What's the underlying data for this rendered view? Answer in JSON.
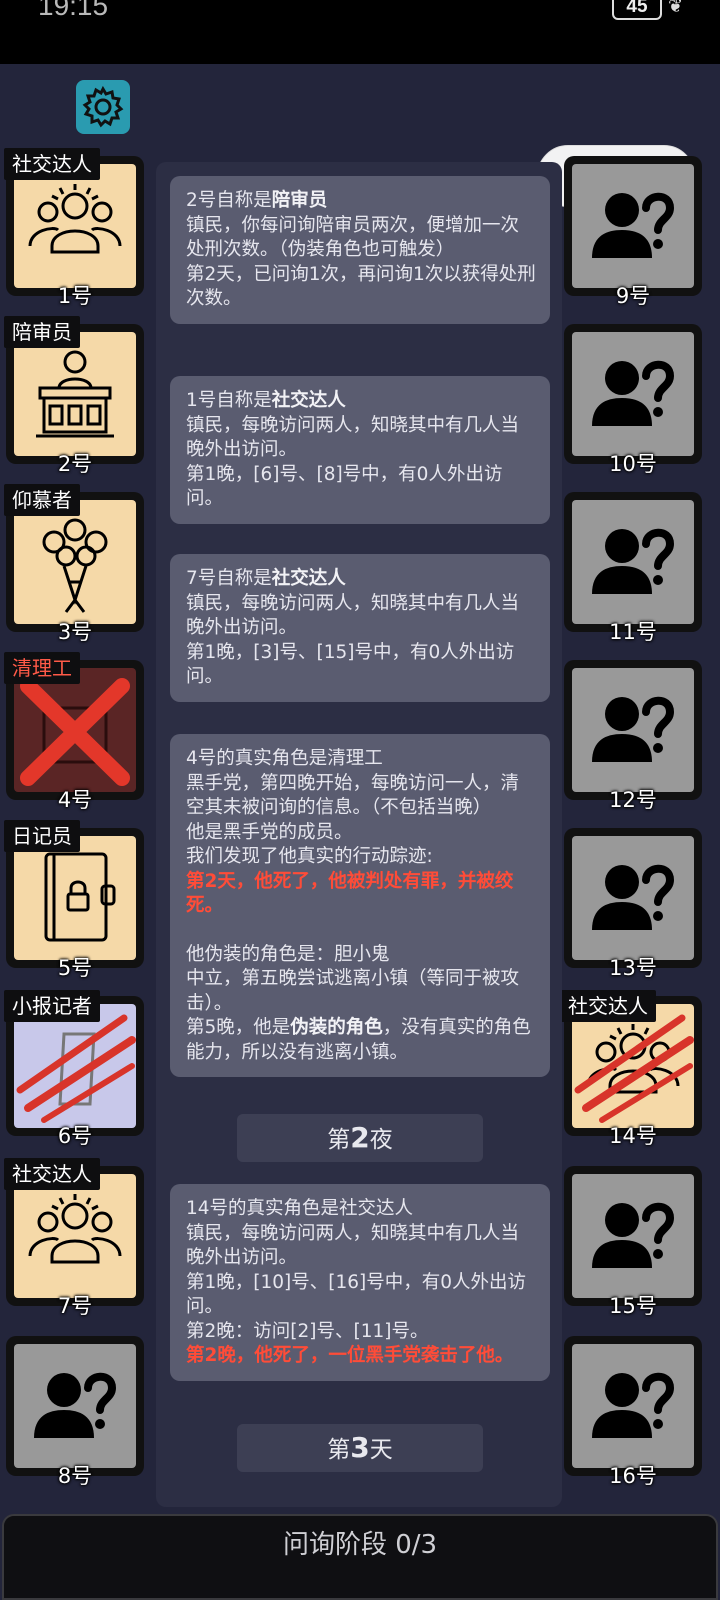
{
  "status_bar": {
    "time": "19:15",
    "battery": "45"
  },
  "colors": {
    "accent_red": "#ff4c38",
    "card_bg": "#5a5c70",
    "page_bg": "#23253b",
    "cream": "#f5d9a8"
  },
  "left_players": [
    {
      "num": "1号",
      "role": "社交达人",
      "icon": "socialite-icon",
      "state": "alive"
    },
    {
      "num": "2号",
      "role": "陪审员",
      "icon": "juror-icon",
      "state": "alive"
    },
    {
      "num": "3号",
      "role": "仰慕者",
      "icon": "bouquet-icon",
      "state": "alive"
    },
    {
      "num": "4号",
      "role": "清理工",
      "icon": "cleaner-icon",
      "state": "executed"
    },
    {
      "num": "5号",
      "role": "日记员",
      "icon": "diary-icon",
      "state": "alive"
    },
    {
      "num": "6号",
      "role": "小报记者",
      "icon": "reporter-icon",
      "state": "attacked"
    },
    {
      "num": "7号",
      "role": "社交达人",
      "icon": "socialite-icon",
      "state": "alive"
    },
    {
      "num": "8号",
      "role": "",
      "icon": "unknown-person-icon",
      "state": "unknown"
    }
  ],
  "right_players": [
    {
      "num": "9号",
      "role": "",
      "icon": "unknown-person-icon",
      "state": "unknown"
    },
    {
      "num": "10号",
      "role": "",
      "icon": "unknown-person-icon",
      "state": "unknown"
    },
    {
      "num": "11号",
      "role": "",
      "icon": "unknown-person-icon",
      "state": "unknown"
    },
    {
      "num": "12号",
      "role": "",
      "icon": "unknown-person-icon",
      "state": "unknown"
    },
    {
      "num": "13号",
      "role": "",
      "icon": "unknown-person-icon",
      "state": "unknown"
    },
    {
      "num": "14号",
      "role": "社交达人",
      "icon": "socialite-icon",
      "state": "attacked"
    },
    {
      "num": "15号",
      "role": "",
      "icon": "unknown-person-icon",
      "state": "unknown"
    },
    {
      "num": "16号",
      "role": "",
      "icon": "unknown-person-icon",
      "state": "unknown"
    }
  ],
  "log": {
    "card1": {
      "head_pre": "2号自称是",
      "head_role": "陪审员",
      "line1": "镇民，你每问询陪审员两次，便增加一次处刑次数。（伪装角色也可触发）",
      "line2": "第2天，已问询1次，再问询1次以获得处刑次数。"
    },
    "card2": {
      "head_pre": "1号自称是",
      "head_role": "社交达人",
      "line1": "镇民，每晚访问两人，知晓其中有几人当晚外出访问。",
      "line2": "第1晚，[6]号、[8]号中，有0人外出访问。"
    },
    "card3": {
      "head_pre": "7号自称是",
      "head_role": "社交达人",
      "line1": "镇民，每晚访问两人，知晓其中有几人当晚外出访问。",
      "line2": "第1晚，[3]号、[15]号中，有0人外出访问。"
    },
    "card4": {
      "head": "4号的真实角色是清理工",
      "line1": "黑手党，第四晚开始，每晚访问一人，清空其未被问询的信息。（不包括当晚）",
      "line2": "他是黑手党的成员。",
      "line3": "我们发现了他真实的行动踪迹:",
      "red": "第2天，他死了，他被判处有罪，并被绞死。",
      "line4": "他伪装的角色是：胆小鬼",
      "line5": "中立，第五晚尝试逃离小镇（等同于被攻击）。",
      "line6_pre": "第5晚，他是",
      "line6_bold": "伪装的角色",
      "line6_post": "，没有真实的角色能力，所以没有逃离小镇。"
    },
    "divider1": {
      "pre": "第",
      "num": "2",
      "post": "夜"
    },
    "card5": {
      "head": "14号的真实角色是社交达人",
      "line1": "镇民，每晚访问两人，知晓其中有几人当晚外出访问。",
      "line2": "第1晚，[10]号、[16]号中，有0人外出访问。",
      "line3": "第2晚：访问[2]号、[11]号。",
      "red": "第2晚，他死了，一位黑手党袭击了他。"
    },
    "divider2": {
      "pre": "第",
      "num": "3",
      "post": "天"
    }
  },
  "bottom_bar": {
    "label": "问询阶段 0/3"
  }
}
